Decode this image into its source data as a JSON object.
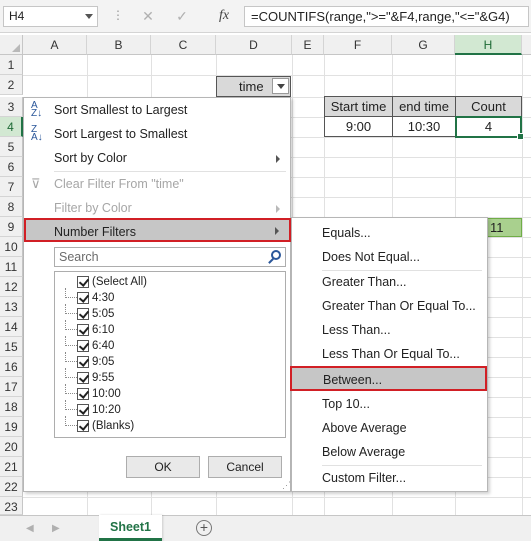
{
  "formula_bar": {
    "name_box": "H4",
    "dots": "⋮",
    "cancel_glyph": "✕",
    "enter_glyph": "✓",
    "fx_label": "fx",
    "formula": "=COUNTIFS(range,\">=\"&F4,range,\"<=\"&G4)"
  },
  "columns": [
    "A",
    "B",
    "C",
    "D",
    "E",
    "F",
    "G",
    "H"
  ],
  "rows": [
    "1",
    "2",
    "3",
    "4",
    "5",
    "6",
    "7",
    "8",
    "9",
    "10",
    "11",
    "12",
    "13",
    "14",
    "15",
    "16",
    "17",
    "18",
    "19",
    "20",
    "21",
    "22",
    "23"
  ],
  "cells": {
    "d2": "time",
    "f3": "Start time",
    "g3": "end time",
    "h3": "Count",
    "f4": "9:00",
    "g4": "10:30",
    "h4": "4",
    "h9": "11"
  },
  "filter_menu": {
    "sort_asc": "Sort Smallest to Largest",
    "sort_desc": "Sort Largest to Smallest",
    "sort_color": "Sort by Color",
    "clear_filter": "Clear Filter From \"time\"",
    "filter_color": "Filter by Color",
    "number_filters": "Number Filters",
    "search_placeholder": "Search",
    "items": [
      "(Select All)",
      "4:30",
      "5:05",
      "6:10",
      "6:40",
      "9:05",
      "9:55",
      "10:00",
      "10:20",
      "(Blanks)"
    ],
    "ok": "OK",
    "cancel": "Cancel"
  },
  "number_filters_submenu": [
    "Equals...",
    "Does Not Equal...",
    "Greater Than...",
    "Greater Than Or Equal To...",
    "Less Than...",
    "Less Than Or Equal To...",
    "Between...",
    "Top 10...",
    "Above Average",
    "Below Average",
    "Custom Filter..."
  ],
  "sheet_tabs": {
    "active": "Sheet1",
    "add_glyph": "+"
  },
  "colors": {
    "accent_green": "#217346",
    "highlight_red": "#d11f25",
    "menu_hover": "#c6c6c6",
    "h9_fill": "#a9d08e"
  }
}
